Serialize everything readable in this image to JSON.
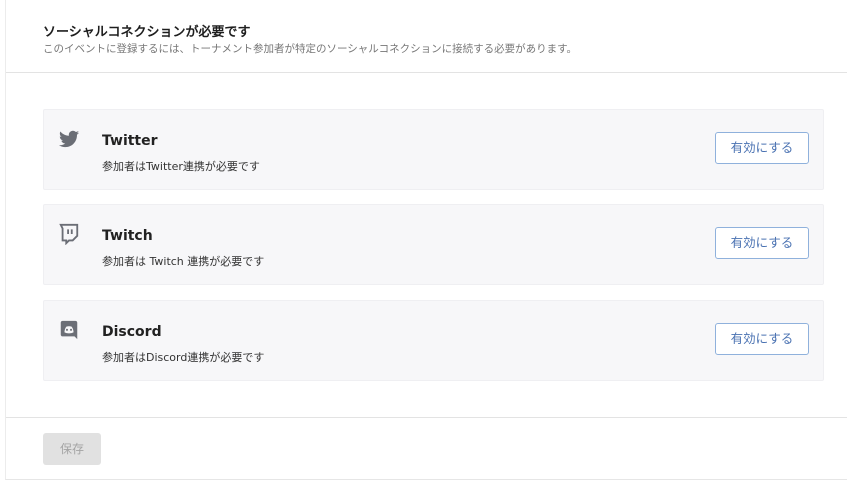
{
  "header": {
    "title": "ソーシャルコネクションが必要です",
    "subtitle": "このイベントに登録するには、トーナメント参加者が特定のソーシャルコネクションに接続する必要があります。"
  },
  "connections": [
    {
      "name": "Twitter",
      "icon": "twitter-icon",
      "description": "参加者はTwitter連携が必要です",
      "button_label": "有効にする"
    },
    {
      "name": "Twitch",
      "icon": "twitch-icon",
      "description": "参加者は Twitch 連携が必要です",
      "button_label": "有効にする"
    },
    {
      "name": "Discord",
      "icon": "discord-icon",
      "description": "参加者はDiscord連携が必要です",
      "button_label": "有効にする"
    }
  ],
  "footer": {
    "save_label": "保存"
  },
  "colors": {
    "icon": "#6b6e76",
    "button_border": "#8fb1dc",
    "button_text": "#4a72b2",
    "row_bg": "#f7f7f9"
  }
}
